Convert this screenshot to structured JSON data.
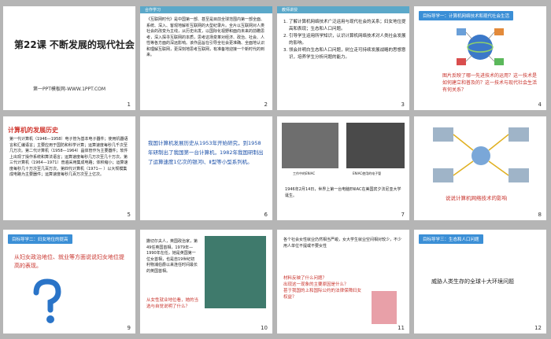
{
  "slides": [
    {
      "num": "1",
      "title": "第22课  不断发展的现代社会",
      "credit": "第一PPT模板网-WWW.1PPT.COM"
    },
    {
      "num": "2",
      "tag": "合作学习",
      "text": "《互联网时代》是中国第一部、甚至是目前全球范围内第一部全面、系统、深入、客观地解析互联网的大型纪录片。全片以互联网对人类社会的改变为主线，从历史出发，以国际化视野和面向未来的前瞻思考，深入探寻互联网的本质，思考这场变革对经济、政治、社会、人性等各方面的深远影响。该作品旨在引导全社会更准确、全面地认识和理解互联网，更深刻地思考互联网，有准备地迎接一个新时代的到来。"
    },
    {
      "num": "3",
      "tag": "教师讲授",
      "items": [
        "了解计算机网络技术广泛运用与现代社会的关系；妇女地位提高和表现；生态和人口问题。",
        "引导学生运用所学知识，认识计算机网络技术对人类社会发展的影响。",
        "领会并明白生态和人口问题，树立走可持续发展战略的思想意识，培养学生分析问题的能力。"
      ]
    },
    {
      "num": "4",
      "heading": "目标导学一：计算机网络技术和现代社会生活",
      "questions": "图片反映了哪一先进技术的运用？这一技术是如何建立和普及的？这一技术与现代社会生活有何关系？"
    },
    {
      "num": "5",
      "title": "计算机的发展历史",
      "text": "第一代计算机（1946—1958）电子管为基本电子器件；使用机器语言和汇编语言；主要应用于国防和科学计算；运算速度每秒几千次至几万次。第二代计算机（1958—1964）晶体管作为主要器件；软件上出现了操作系统和算法语言；运算速度每秒几万次至几十万次。第三代计算机（1964—1971）普遍采用集成电路；体积缩小；运算速度每秒几十万次至几百万次。第四代计算机（1971— ）以大规模集成电路为主要器件；运算速度每秒几百万次至上亿次。"
    },
    {
      "num": "6",
      "text": "我国计算机发展历史从1953年开始研究，到1958年研制出了我国第一台计算机，1982年我国研制出了运算速度1亿次的银河Ⅰ、Ⅱ型等小型系列机。"
    },
    {
      "num": "7",
      "cap1": "工作中的ENIAC",
      "cap2": "ENIAC使用的电子管",
      "text": "1946年2月14日，世界上第一台电脑ENIAC在美国宾夕法尼亚大学诞生。"
    },
    {
      "num": "8",
      "text": "说说计算机网络技术的影响"
    },
    {
      "num": "9",
      "heading": "目标导学二：妇女地位的提高",
      "text": "从妇女政治地位、就业等方面说说妇女地位提高的表现。"
    },
    {
      "num": "10",
      "text": "撒切尔夫人，英国政治家，第49任英国首相，1979年—1990年在任，她是英国第一位女首相，也是自19世纪初利物浦伯爵以来连任时间最长的英国首相。",
      "question": "从女性就业地位看，她的当选与自觉说明了什么？"
    },
    {
      "num": "11",
      "text": "各个社会女性就业仍然相当严峻，女大学生就业空间相对较少，不少用人单位不提或不要女性",
      "q1": "材料反映了什么问题？",
      "q2": "出现这一现象的主要原因是什么？",
      "q3": "甚于我国的上和国际公约的法律保障妇女权益？"
    },
    {
      "num": "12",
      "heading": "目标导学三：生态和人口问题",
      "text": "威胁人类生存的全球十大环境问题"
    }
  ]
}
